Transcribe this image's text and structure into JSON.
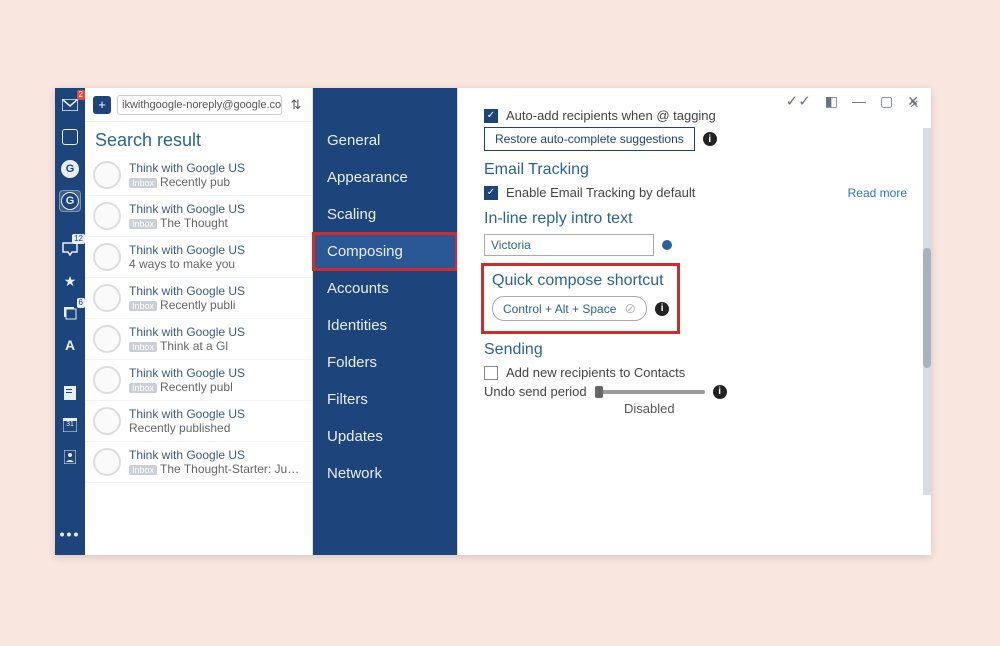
{
  "sidebar_icons": {
    "mail_badge": "2",
    "g1_letter": "G",
    "g2_letter": "G",
    "tray_badge": "12",
    "docs_badge": "6",
    "cal_badge": "31"
  },
  "topbar": {
    "address": "ikwithgoogle-noreply@google.com"
  },
  "search_title": "Search result",
  "threads": [
    {
      "from": "Think with Google US",
      "line2_tag": "Inbox",
      "line2": "Recently pub"
    },
    {
      "from": "Think with Google US",
      "line2_tag": "Inbox",
      "line2": "The Thought"
    },
    {
      "from": "Think with Google US",
      "line2_tag": "",
      "line2": "4 ways to make you"
    },
    {
      "from": "Think with Google US",
      "line2_tag": "Inbox",
      "line2": "Recently publi"
    },
    {
      "from": "Think with Google US",
      "line2_tag": "Inbox",
      "line2": "Think at a Gl"
    },
    {
      "from": "Think with Google US",
      "line2_tag": "Inbox",
      "line2": "Recently publ"
    },
    {
      "from": "Think with Google US",
      "line2_tag": "",
      "line2": "Recently published "
    },
    {
      "from": "Think with Google US",
      "line2_tag": "Inbox",
      "line2": "The Thought-Starter: June..."
    }
  ],
  "settings_nav": [
    "General",
    "Appearance",
    "Scaling",
    "Composing",
    "Accounts",
    "Identities",
    "Folders",
    "Filters",
    "Updates",
    "Network"
  ],
  "settings_selected": "Composing",
  "panel": {
    "autoadd_label": "Auto-add recipients when @ tagging",
    "restore_btn": "Restore auto-complete suggestions",
    "tracking_title": "Email Tracking",
    "tracking_label": "Enable Email Tracking by default",
    "readmore": "Read more",
    "inline_title": "In-line reply intro text",
    "inline_value": "Victoria",
    "quick_title": "Quick compose shortcut",
    "quick_value": "Control + Alt + Space",
    "sending_title": "Sending",
    "sending_add_label": "Add new recipients to Contacts",
    "undo_label": "Undo send period",
    "undo_value": "Disabled"
  }
}
